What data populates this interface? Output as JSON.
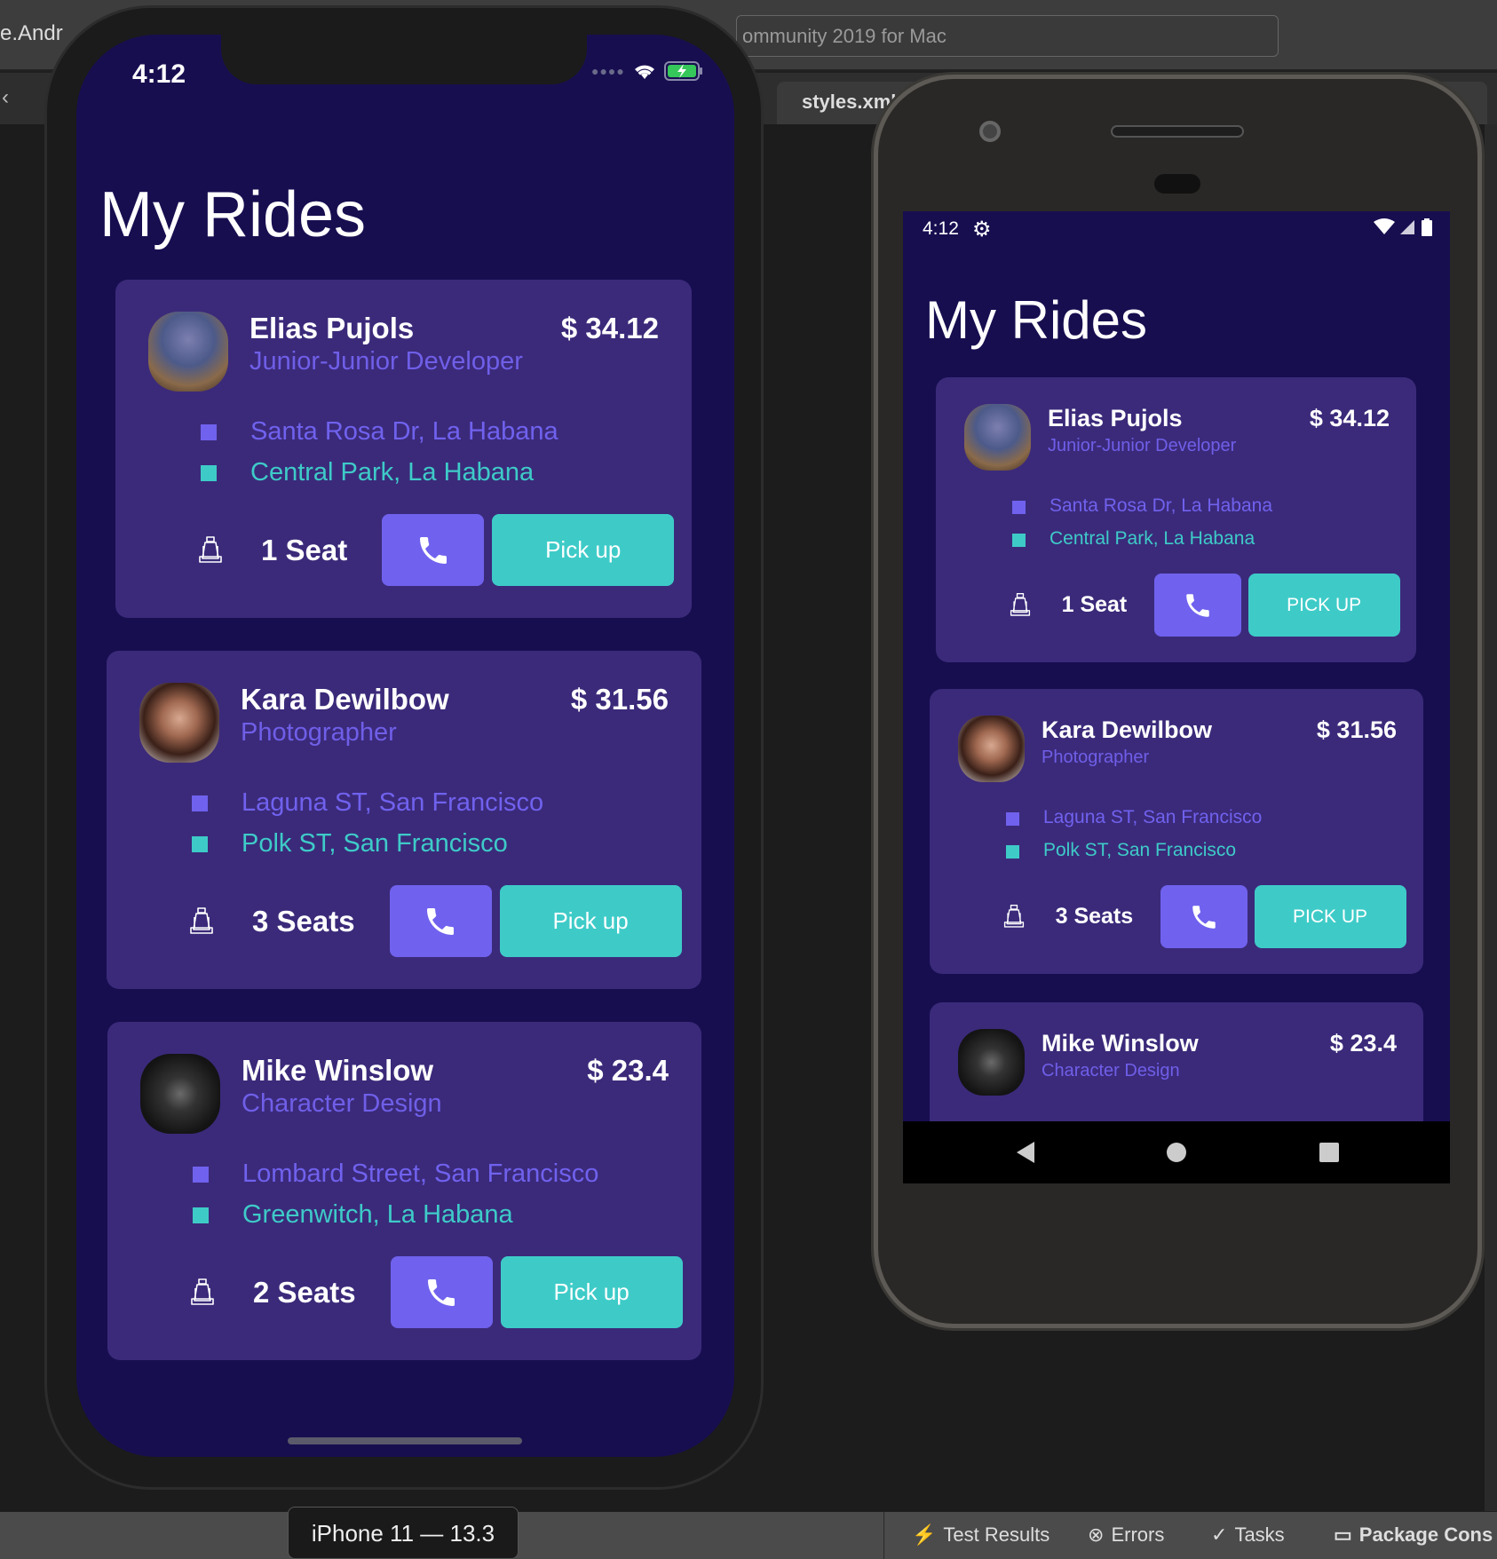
{
  "ide": {
    "window_title_left": "e.Andr",
    "address_text": "ommunity 2019 for Mac",
    "back_icon": "chevron-left",
    "tab_label": "styles.xml",
    "device_label": "iPhone 11 — 13.3",
    "bottom_tabs": [
      {
        "label": "Test Results",
        "icon": "⚡"
      },
      {
        "label": "Errors",
        "icon": "⊗"
      },
      {
        "label": "Tasks",
        "icon": "✓"
      },
      {
        "label": "Package Cons",
        "icon": "▭"
      }
    ]
  },
  "colors": {
    "background": "#170e50",
    "card": "#3b2a7a",
    "accent_purple": "#7062ee",
    "accent_teal": "#3ecbc8"
  },
  "ios": {
    "time": "4:12",
    "title": "My Rides",
    "pickup_label": "Pick up"
  },
  "android": {
    "time": "4:12",
    "title": "My Rides",
    "pickup_label": "PICK UP"
  },
  "rides": [
    {
      "name": "Elias Pujols",
      "role": "Junior-Junior Developer",
      "price": "$ 34.12",
      "from": "Santa Rosa Dr, La Habana",
      "to": "Central Park, La Habana",
      "seats": "1 Seat"
    },
    {
      "name": "Kara Dewilbow",
      "role": "Photographer",
      "price": "$ 31.56",
      "from": "Laguna ST, San Francisco",
      "to": "Polk ST, San Francisco",
      "seats": "3 Seats"
    },
    {
      "name": "Mike Winslow",
      "role": "Character Design",
      "price": "$ 23.4",
      "from": "Lombard Street, San Francisco",
      "to": "Greenwitch, La Habana",
      "seats": "2 Seats"
    }
  ]
}
